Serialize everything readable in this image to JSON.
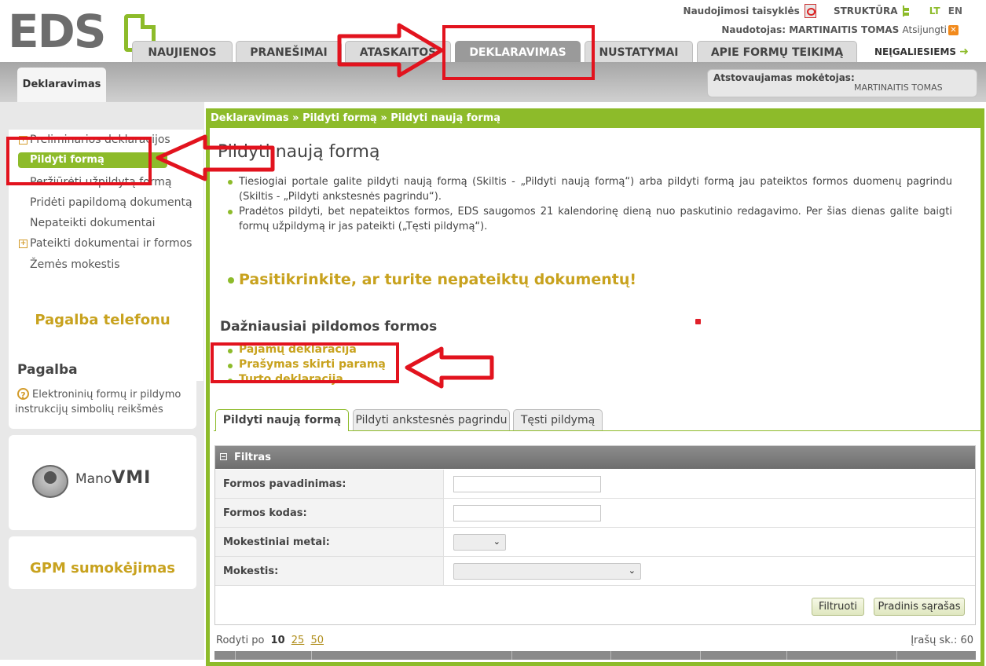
{
  "header": {
    "logo_text": "EDS",
    "links": {
      "rules": "Naudojimosi taisyklės",
      "structure": "STRUKTŪRA",
      "lang_lt": "LT",
      "lang_en": "EN"
    },
    "user_label": "Naudotojas: MARTINAITIS TOMAS",
    "logout": "Atsijungti"
  },
  "main_tabs": [
    {
      "label": "NAUJIENOS"
    },
    {
      "label": "PRANEŠIMAI"
    },
    {
      "label": "ATASKAITOS"
    },
    {
      "label": "DEKLARAVIMAS",
      "active": true
    },
    {
      "label": "NUSTATYMAI"
    },
    {
      "label": "APIE FORMŲ TEIKIMĄ"
    }
  ],
  "accessibility_link": "NEĮGALIESIEMS",
  "subtab": "Deklaravimas",
  "payer": {
    "label": "Atstovaujamas mokėtojas:",
    "name": "MARTINAITIS TOMAS"
  },
  "sidebar": {
    "menu": [
      {
        "label": "Preliminarios deklaracijos",
        "has_plus": true
      },
      {
        "label": "Pildyti formą",
        "active": true
      },
      {
        "label": "Peržiūrėti užpildytą formą"
      },
      {
        "label": "Pridėti papildomą dokumentą"
      },
      {
        "label": "Nepateikti dokumentai"
      },
      {
        "label": "Pateikti dokumentai ir formos",
        "has_plus": true
      },
      {
        "label": "Žemės mokestis"
      }
    ],
    "phone_help": "Pagalba telefonu",
    "help_title": "Pagalba",
    "help_text": "Elektroninių formų ir pildymo instrukcijų simbolių reikšmės",
    "mano_prefix": "Mano",
    "mano_suffix": "VMI",
    "gpm": "GPM sumokėjimas"
  },
  "breadcrumb": "Deklaravimas » Pildyti formą » Pildyti naują formą",
  "page_title": "Pildyti naują formą",
  "info": [
    "Tiesiogiai portale galite pildyti naują formą (Skiltis - „Pildyti naują formą“) arba pildyti formą jau pateiktos formos duomenų pagrindu (Skiltis - „Pildyti ankstesnės pagrindu“).",
    "Pradėtos pildyti, bet nepateiktos formos, EDS saugomos 21 kalendorinę dieną nuo paskutinio redagavimo. Per šias dienas galite baigti formų užpildymą ir jas pateikti („Tęsti pildymą“)."
  ],
  "check_link": "Pasitikrinkite, ar turite nepateiktų dokumentų!",
  "frequent_title": "Dažniausiai pildomos formos",
  "frequent_forms": [
    "Pajamų deklaracija",
    "Prašymas skirti paramą",
    "Turto deklaracija"
  ],
  "inner_tabs": [
    {
      "label": "Pildyti naują formą",
      "active": true
    },
    {
      "label": "Pildyti ankstesnės pagrindu"
    },
    {
      "label": "Tęsti pildymą"
    }
  ],
  "filter": {
    "title": "Filtras",
    "fields": {
      "name_label": "Formos pavadinimas:",
      "name_value": "",
      "code_label": "Formos kodas:",
      "code_value": "",
      "year_label": "Mokestiniai metai:",
      "year_value": "",
      "tax_label": "Mokestis:",
      "tax_value": ""
    },
    "filter_button": "Filtruoti",
    "reset_button": "Pradinis sąrašas"
  },
  "pagination": {
    "show_label": "Rodyti po",
    "sizes": [
      "10",
      "25",
      "50"
    ],
    "count_label": "Įrašų sk.: 60"
  },
  "colors": {
    "accent_green": "#8dbb2a",
    "link_gold": "#c8a21e",
    "annotation_red": "#e2131e"
  }
}
